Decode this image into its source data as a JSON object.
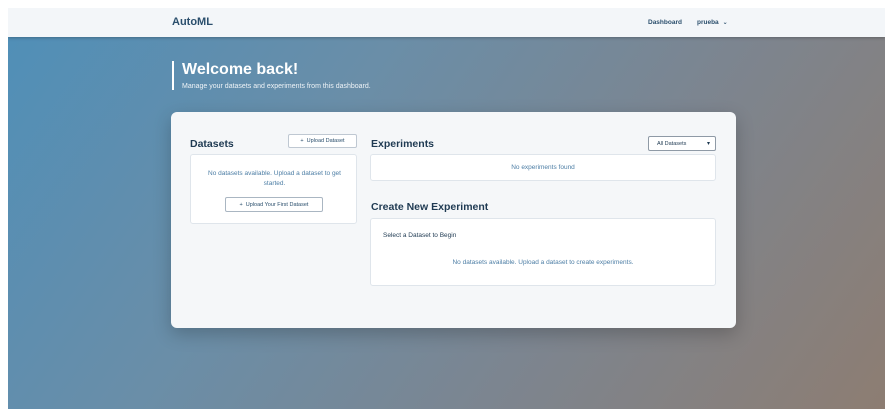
{
  "navbar": {
    "brand": "AutoML",
    "dashboard_link": "Dashboard",
    "user": "prueba"
  },
  "welcome": {
    "title": "Welcome back!",
    "subtitle": "Manage your datasets and experiments from this dashboard."
  },
  "datasets": {
    "title": "Datasets",
    "upload_label": "Upload Dataset",
    "empty_text": "No datasets available. Upload a dataset to get started.",
    "first_upload_label": "Upload Your First Dataset"
  },
  "experiments": {
    "title": "Experiments",
    "filter_selected": "All Datasets",
    "empty_text": "No experiments found"
  },
  "create": {
    "title": "Create New Experiment",
    "select_label": "Select a Dataset to Begin",
    "empty_text": "No datasets available. Upload a dataset to create experiments."
  },
  "icons": {
    "plus": "plus-icon",
    "chevron": "chevron-down-icon"
  },
  "colors": {
    "brand": "#2b4f6d",
    "accent_text": "#4d7ea5",
    "card_bg": "#f5f7f9"
  }
}
